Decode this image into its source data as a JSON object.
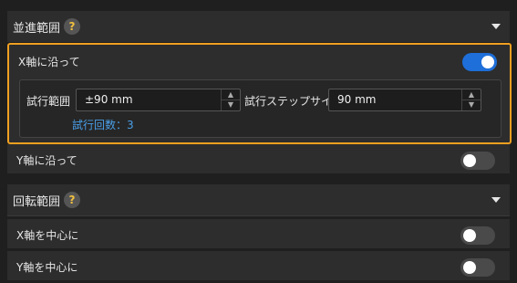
{
  "translation_section": {
    "title": "並進範囲",
    "help_icon": "?",
    "x_axis": {
      "label": "X軸に沿って",
      "enabled": true,
      "trial_range_label": "試行範囲",
      "trial_range_value": "±90 mm",
      "trial_step_label": "試行ステップサイズ",
      "trial_step_value": "90 mm",
      "trial_count": "試行回数：3"
    },
    "y_axis": {
      "label": "Y軸に沿って",
      "enabled": false
    }
  },
  "rotation_section": {
    "title": "回転範囲",
    "help_icon": "?",
    "x_center": {
      "label": "X軸を中心に",
      "enabled": false
    },
    "y_center": {
      "label": "Y軸を中心に",
      "enabled": false
    }
  },
  "colors": {
    "background": "#1f1f1f",
    "panel": "#2d2d2d",
    "accent_blue": "#1e6fd9",
    "highlight_orange": "#f0a020",
    "help_icon_yellow": "#f0c040"
  }
}
